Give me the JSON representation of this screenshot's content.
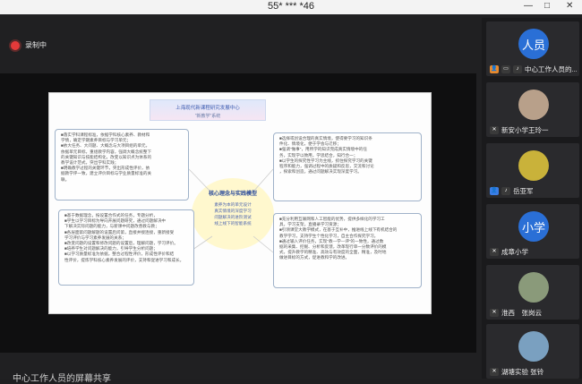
{
  "window": {
    "title": "55* *** *46",
    "controls": {
      "minimize": "—",
      "maximize": "□",
      "close": "✕"
    }
  },
  "recording": {
    "label": "录制中",
    "icon": "record-dot-icon",
    "color": "#e43a3a"
  },
  "slide": {
    "header_line1": "上海现代新课程研究发展中心",
    "header_line2": "\"新教学\"系统",
    "center_title": "核心理念与实践模型",
    "center_body": [
      "素养为本的单元设计",
      "真实情境的深度学习",
      "问题解决的进阶测试",
      "线上线下的智能系统"
    ],
    "clouds": [
      {
        "lines": [
          "■落实学科课程标准，依据学科核心素养、教材和",
          "学情，确定学期素养目标与学习单元；",
          "■依大任务、大问题、大概念与大项目组的单元，",
          "依据单元目标，重组教学内容，强调大概念统整下",
          "的关键知识与技能结构化，改变以知识点为体系的",
          "教学设计范式，突出学科实践；",
          "■明确教学过程的关键环节，突出形成性评价，依",
          "据教学评一致，建立评价目标与学业质量标准的关",
          "联。"
        ]
      },
      {
        "lines": [
          "■选择或创设合理的真实情境，使得要学习的知识条",
          "件化、情境化，便于学会与迁移；",
          "■强调\"做事\"，用所学的知识完成真实情境中的任",
          "务，实现学以致用，学思结合，知行合一；",
          "■以学生的探究性学习为主线，抓住探究学习的关键",
          "程序和能力，强调过程中的质疑和反思，交流和讨论",
          "，探索和创造，通过问题解决实现深度学习。"
        ]
      },
      {
        "lines": [
          "■基于数据理念，按设置合作式的任务，专题分析，",
          "■学生以学习目标为导向开展问题研究，通过问题解决中",
          "下解决实际问题的能力，与新课中问题改善教与教；",
          "■各层面第问题解题的设置后问第，直接并接连接，重新接受",
          "学习评价与学习素养发展的关系；",
          "■改变问题的设置和修改问题的设置后，理解问题，学习评价。",
          "■培养学生对问题解决的能力，引导学生分析问题；",
          "■以学习质量标准为依据，整合过程性评价，形成性评价和结",
          "性评价，提炼学科核心素养发展的评价，支持和促进学习和成长。"
        ]
      },
      {
        "lines": [
          "■充分利用互联网和人工智能的优势，提供多样化的学习工",
          "具，学习支架，直播录学习资源；",
          "■引领课堂大教学模式，在基于互补中，推进线上线下有机结合的",
          "教学学习，支持学生个性化学习，自主合作探究学习。",
          "■通过输入评价任务，实现\"教—学—评\"的一致性，通过数",
          "据的采集、挖掘、分析和反馈，改革现行单一分数评价的模",
          "式，提升教学的精准、高效与有效度的全面，精准，及时地",
          "做进目标的方式，促进教和学的改进。"
        ]
      }
    ]
  },
  "bottom_caption": "中心工作人员的屏幕共享",
  "participants": [
    {
      "avatar_text": "人员",
      "avatar_color": "#2a6fd6",
      "name": "中心工作人员的...",
      "icons": [
        "person-icon",
        "screen-share-icon",
        "mic-icon"
      ]
    },
    {
      "avatar_text": "",
      "avatar_color": "#b8a08a",
      "name": "新安小学王玲一",
      "icons": [
        "mic-muted-icon"
      ]
    },
    {
      "avatar_text": "",
      "avatar_color": "#c9b23a",
      "name": "岳亚军",
      "icons": [
        "person-icon",
        "mic-icon"
      ]
    },
    {
      "avatar_text": "小学",
      "avatar_color": "#2a6fd6",
      "name": "成章小学",
      "icons": [
        "mic-muted-icon"
      ]
    },
    {
      "avatar_text": "",
      "avatar_color": "#8a9a7a",
      "name": "淮西　张岗云",
      "icons": [
        "mic-muted-icon"
      ]
    },
    {
      "avatar_text": "",
      "avatar_color": "#7aa0c0",
      "name": "湖塘实验 张铃",
      "icons": [
        "mic-muted-icon"
      ]
    }
  ]
}
